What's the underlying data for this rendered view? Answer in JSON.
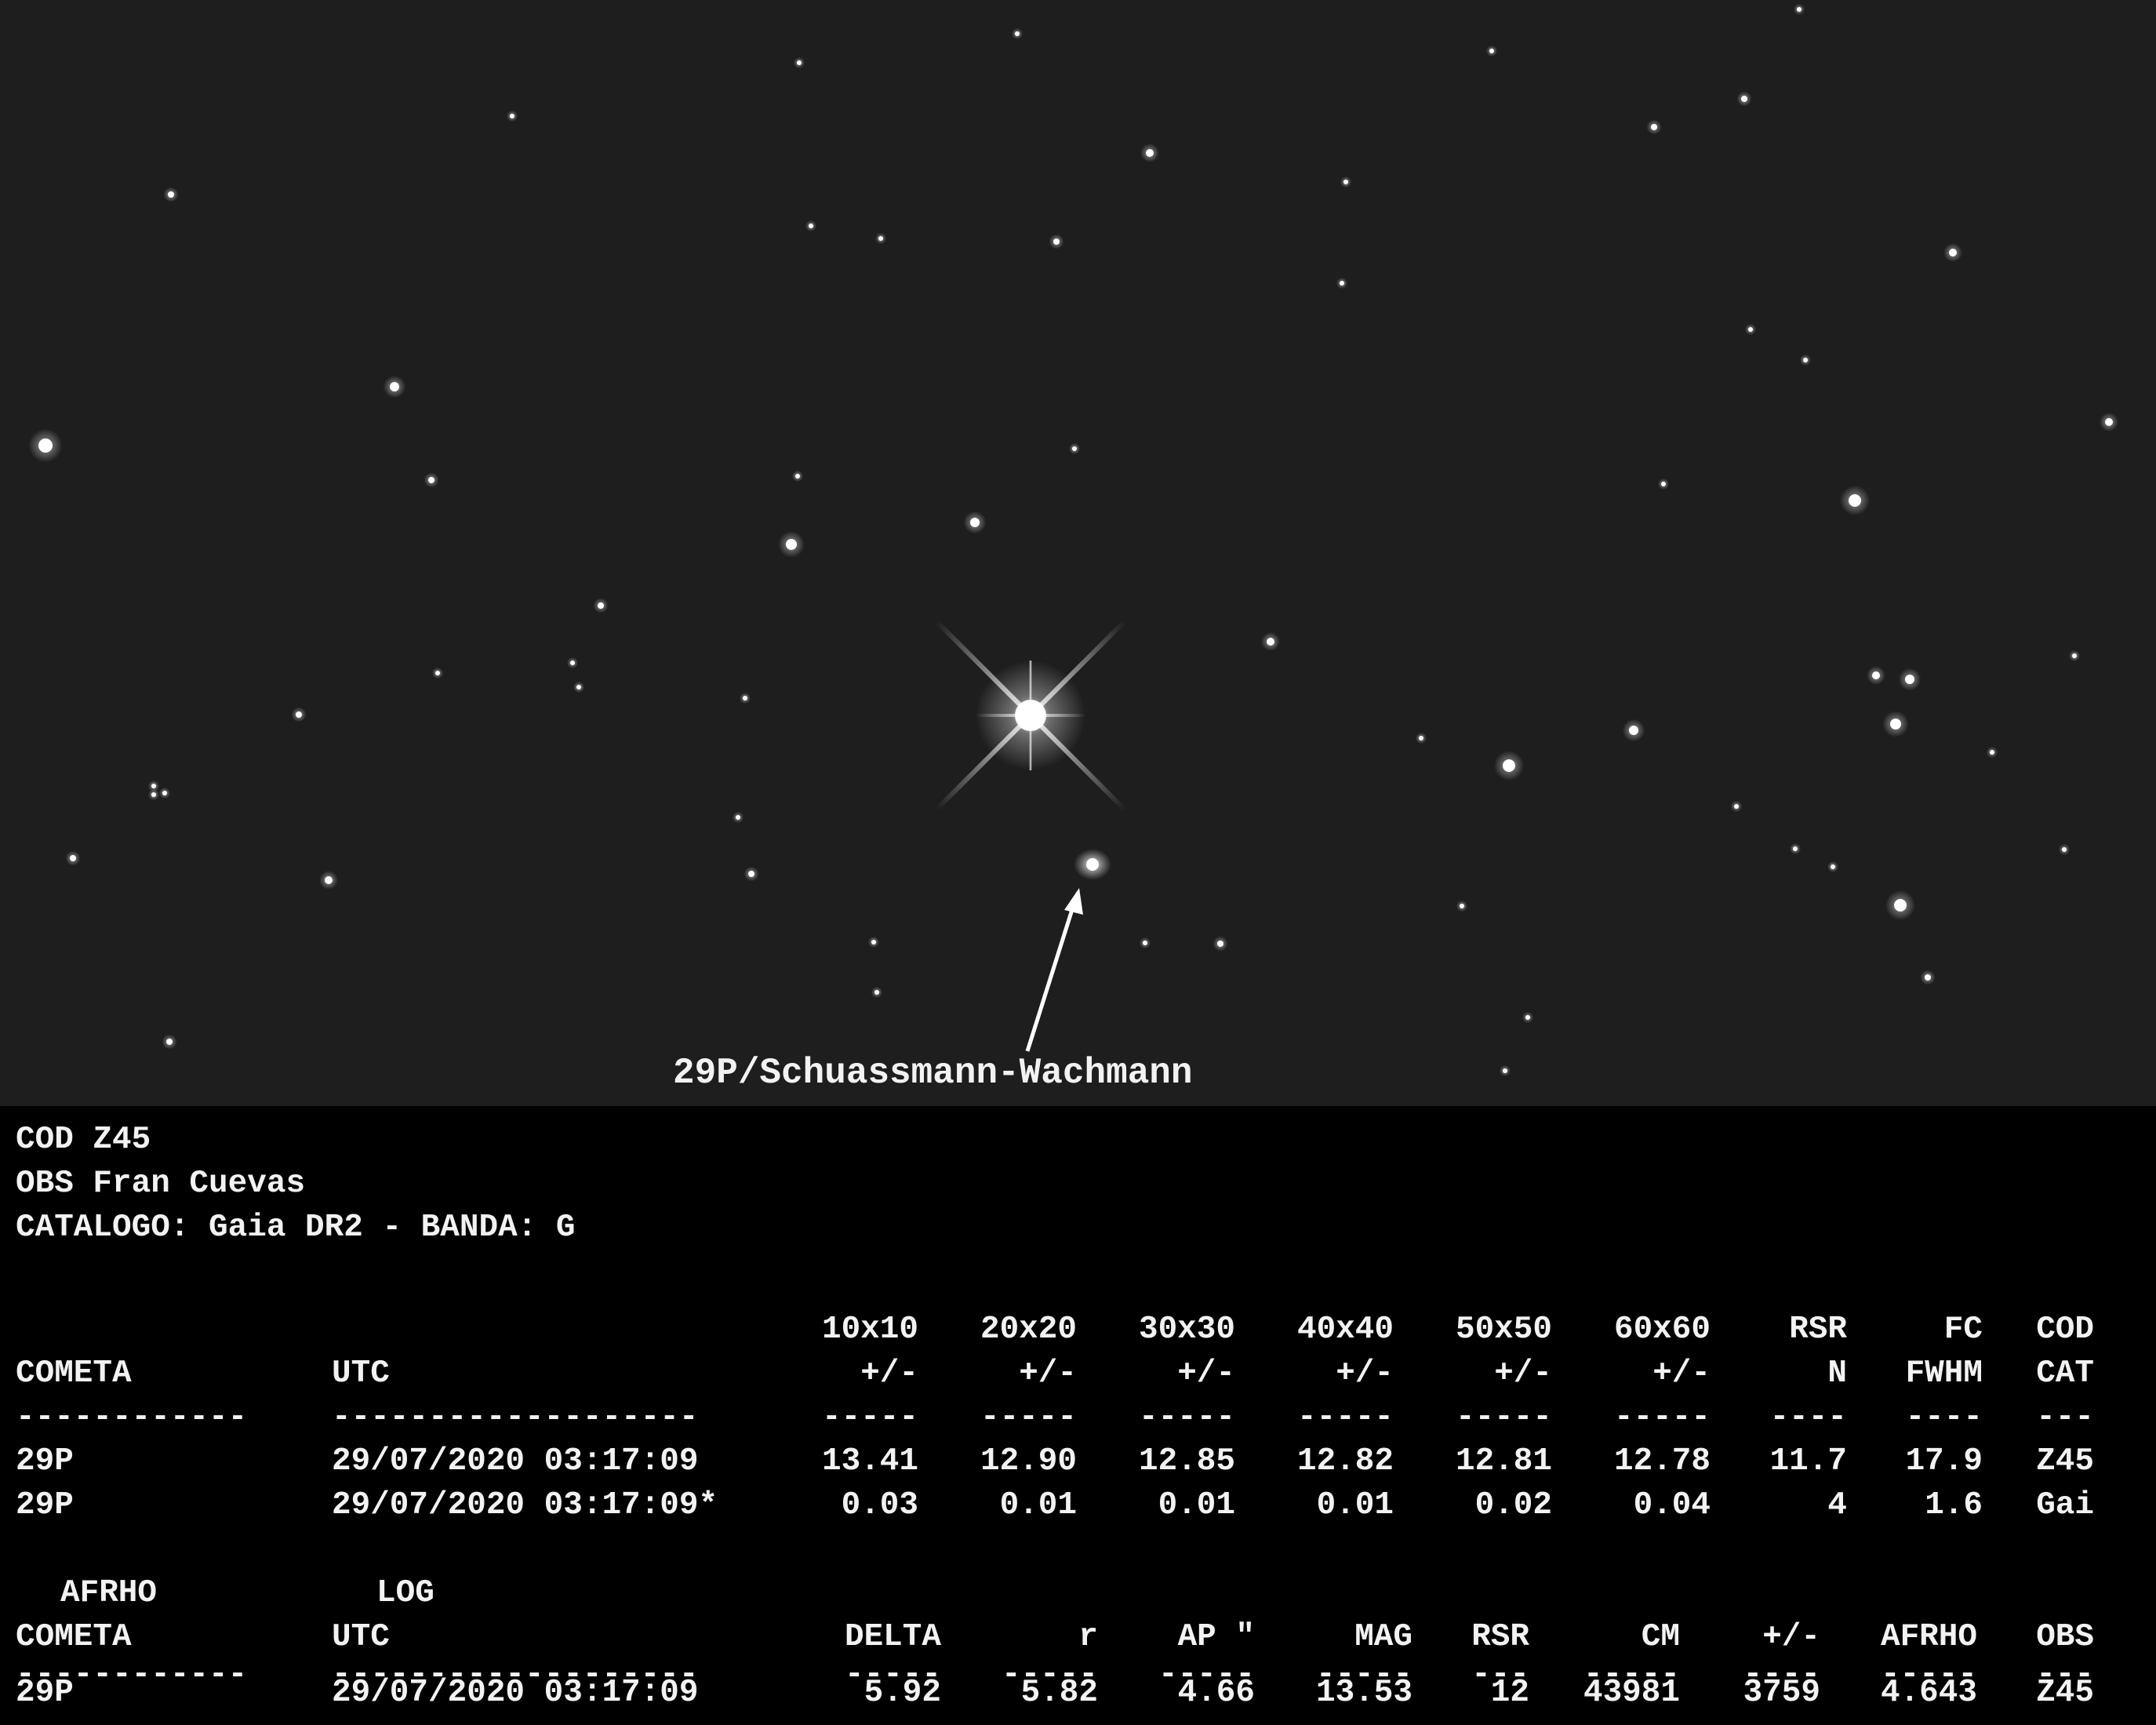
{
  "comet_label": "29P/Schuassmann-Wachmann",
  "colors": {
    "sky": "#1e1e1e",
    "text": "#f2f2f2",
    "star": "#ffffff"
  },
  "header": [
    "COD Z45",
    "OBS Fran Cuevas",
    "CATALOGO: Gaia DR2 - BANDA: G"
  ],
  "table1": {
    "head_top": [
      "",
      "",
      "10x10",
      "20x20",
      "30x30",
      "40x40",
      "50x50",
      "60x60",
      "RSR",
      "FC",
      "COD"
    ],
    "head": [
      "COMETA",
      "UTC",
      "+/-",
      "+/-",
      "+/-",
      "+/-",
      "+/-",
      "+/-",
      "N",
      "FWHM",
      "CAT"
    ],
    "dashes": [
      "------------",
      "-------------------",
      "-----",
      "-----",
      "-----",
      "-----",
      "-----",
      "-----",
      "----",
      "----",
      "---"
    ],
    "rows": [
      [
        "29P",
        "29/07/2020 03:17:09",
        "13.41",
        "12.90",
        "12.85",
        "12.82",
        "12.81",
        "12.78",
        "11.7",
        "17.9",
        "Z45"
      ],
      [
        "29P",
        "29/07/2020 03:17:09*",
        "0.03",
        "0.01",
        "0.01",
        "0.01",
        "0.02",
        "0.04",
        "4",
        "1.6",
        "Gai"
      ]
    ]
  },
  "table2": {
    "head_top": [
      "AFRHO",
      "LOG"
    ],
    "head": [
      "COMETA",
      "UTC",
      "DELTA",
      "r",
      "AP \"",
      "MAG",
      "RSR",
      "CM",
      "+/-",
      "AFRHO",
      "OBS"
    ],
    "dashes": [
      "------------",
      "-------------------",
      "-----",
      "-----",
      "-----",
      "-----",
      "---",
      "-----",
      "----",
      "-----",
      "---"
    ],
    "rows": [
      [
        "29P",
        "29/07/2020 03:17:09",
        "5.92",
        "5.82",
        "4.66",
        "13.53",
        "12",
        "43981",
        "3759",
        "4.643",
        "Z45"
      ]
    ]
  }
}
